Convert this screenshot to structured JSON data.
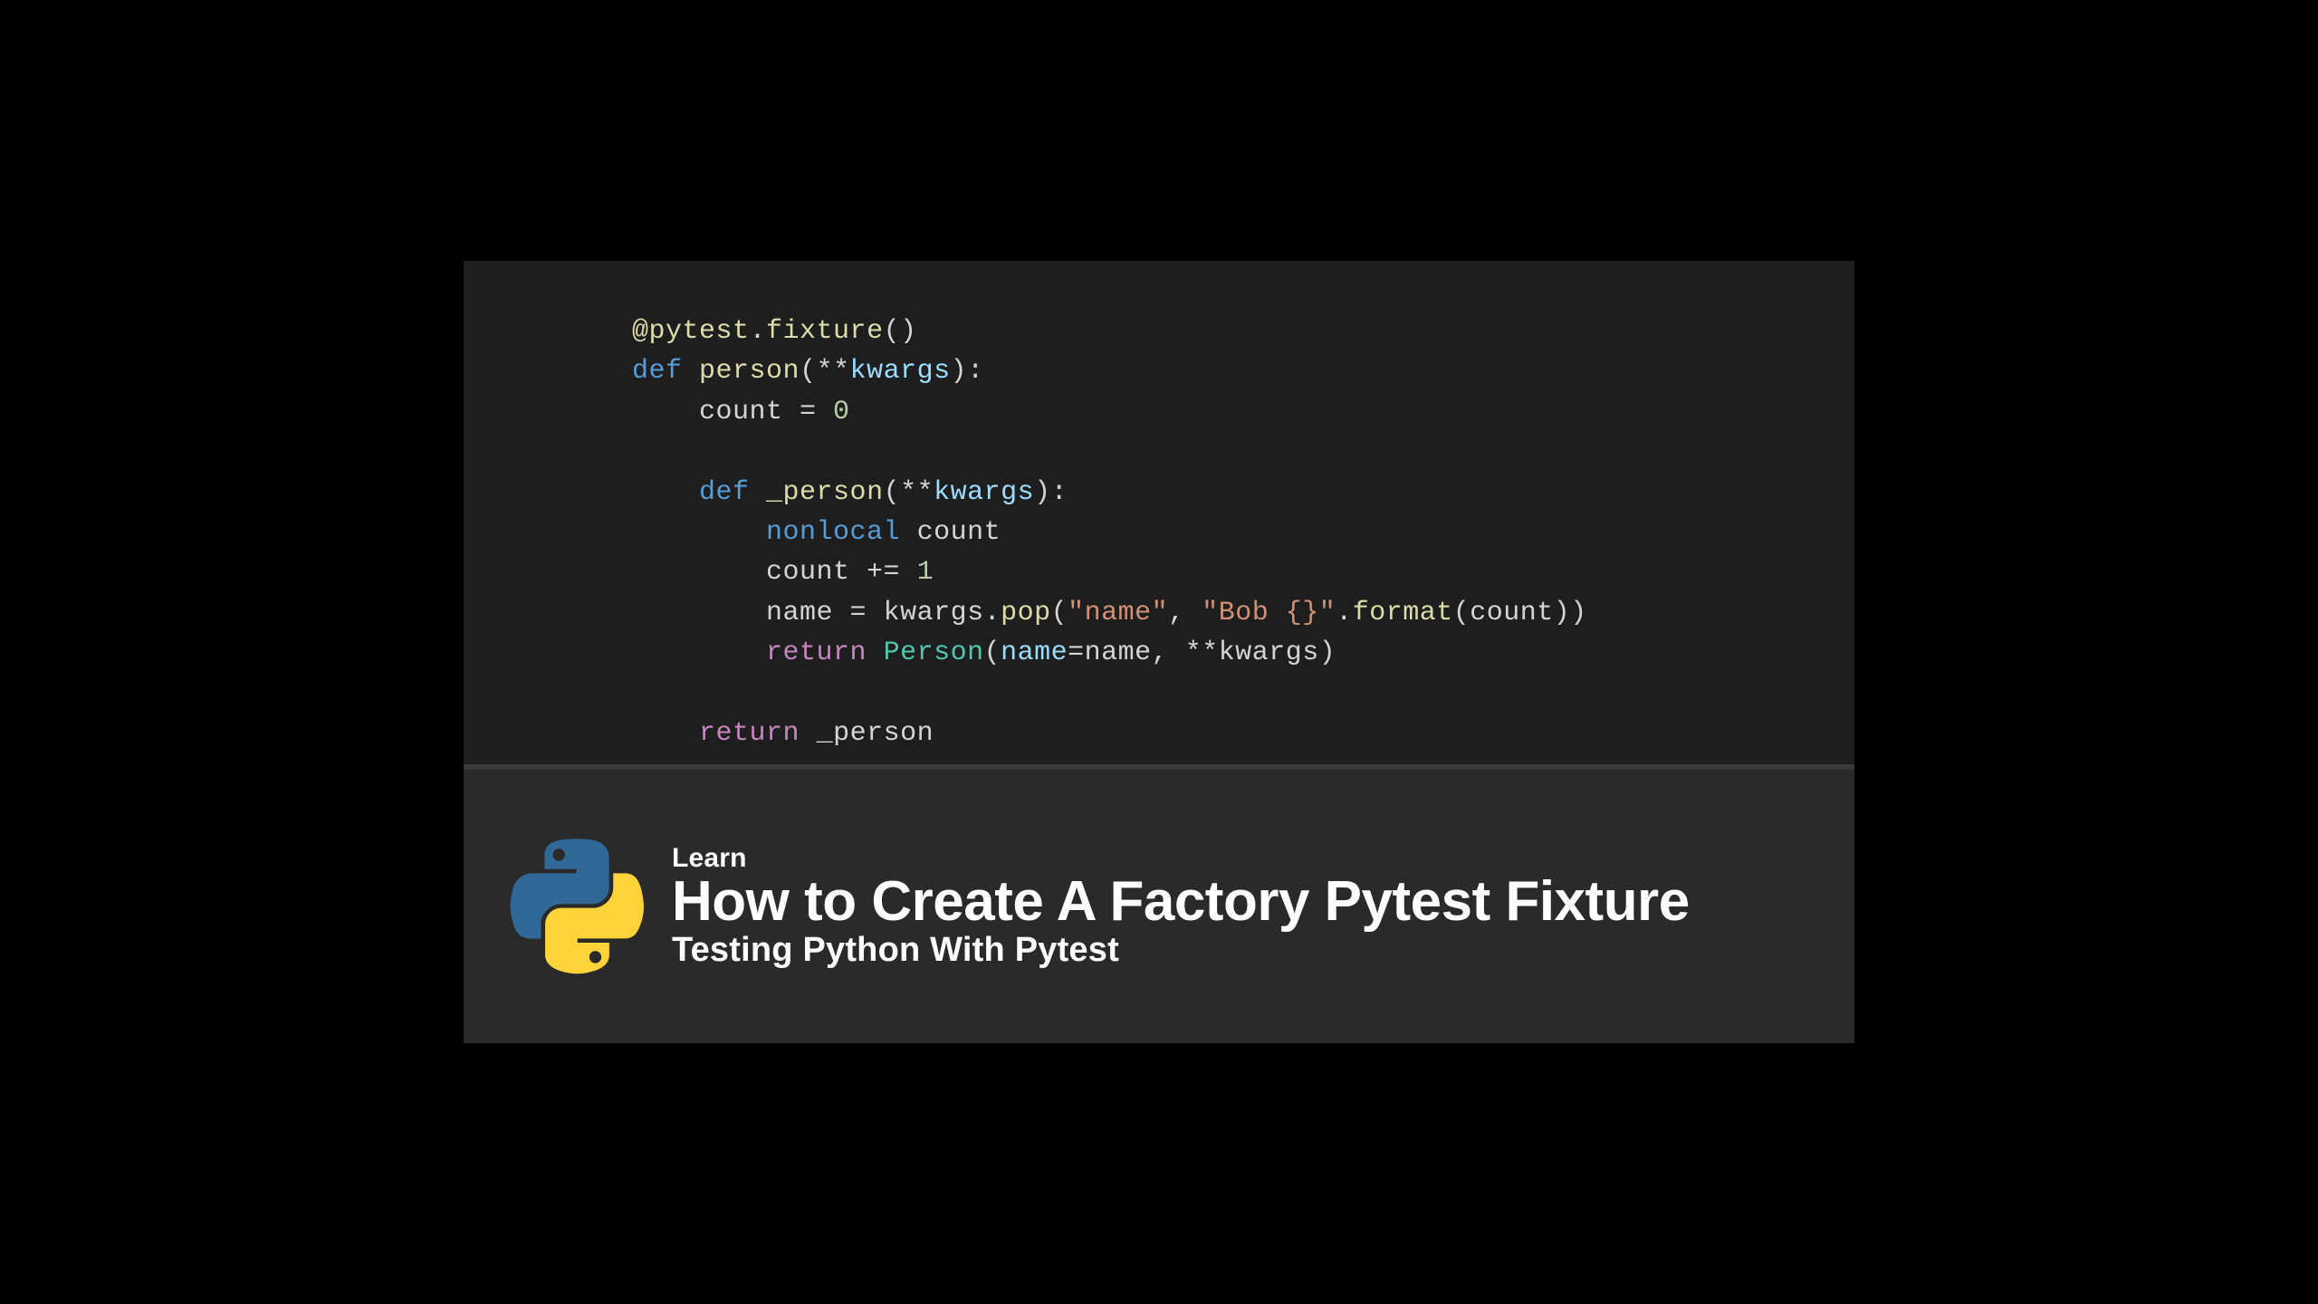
{
  "code": {
    "l1": {
      "dec": "@pytest",
      "dot": ".",
      "fix": "fixture",
      "par": "()"
    },
    "l2": {
      "def": "def",
      "sp": " ",
      "name": "person",
      "lp": "(",
      "op": "**",
      "arg": "kwargs",
      "rp": "):"
    },
    "l3": {
      "indent": "    ",
      "var": "count",
      "eq": " = ",
      "num": "0"
    },
    "l4": {
      "blank": ""
    },
    "l5": {
      "indent": "    ",
      "def": "def",
      "sp": " ",
      "name": "_person",
      "lp": "(",
      "op": "**",
      "arg": "kwargs",
      "rp": "):"
    },
    "l6": {
      "indent": "        ",
      "kw": "nonlocal",
      "sp": " ",
      "var": "count"
    },
    "l7": {
      "indent": "        ",
      "var": "count",
      "op": " += ",
      "num": "1"
    },
    "l8": {
      "indent": "        ",
      "lhs": "name",
      "eq": " = ",
      "obj": "kwargs",
      "dot": ".",
      "call": "pop",
      "lp": "(",
      "s1": "\"name\"",
      "comma": ", ",
      "s2": "\"Bob {}\"",
      "dot2": ".",
      "call2": "format",
      "lp2": "(",
      "arg": "count",
      "rp2": "))"
    },
    "l9": {
      "indent": "        ",
      "ret": "return",
      "sp": " ",
      "cls": "Person",
      "lp": "(",
      "kw1": "name",
      "eq": "=",
      "val1": "name",
      "comma": ", ",
      "op": "**",
      "arg": "kwargs",
      "rp": ")"
    },
    "l10": {
      "blank": ""
    },
    "l11": {
      "indent": "    ",
      "ret": "return",
      "sp": " ",
      "id": "_person"
    }
  },
  "logo": {
    "name": "python-logo-icon",
    "colors": {
      "blue": "#306998",
      "yellow": "#FFD43B"
    }
  },
  "banner": {
    "kicker": "Learn",
    "title": "How to Create A Factory Pytest Fixture",
    "subtitle": "Testing Python With Pytest"
  }
}
